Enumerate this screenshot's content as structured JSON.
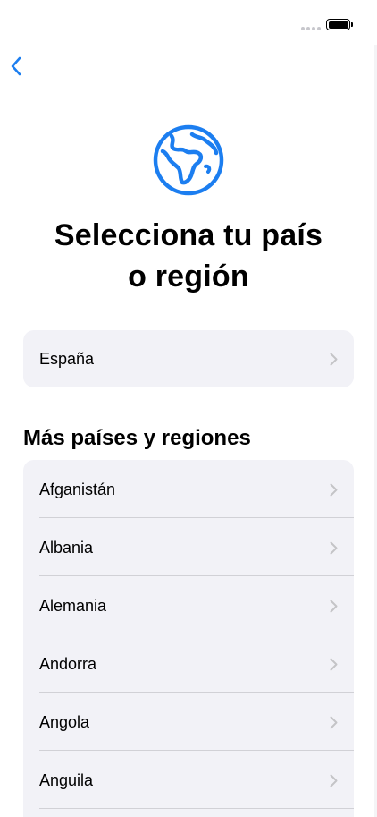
{
  "status_bar": {
    "signal_icon": "cellular-signal-icon",
    "battery_icon": "battery-full-icon"
  },
  "nav": {
    "back_icon": "chevron-left-icon"
  },
  "hero": {
    "icon": "globe-icon",
    "title_line1": "Selecciona tu país",
    "title_line2": "o región"
  },
  "current_region": {
    "label": "España"
  },
  "more_section": {
    "header": "Más países y regiones",
    "items": [
      {
        "label": "Afganistán"
      },
      {
        "label": "Albania"
      },
      {
        "label": "Alemania"
      },
      {
        "label": "Andorra"
      },
      {
        "label": "Angola"
      },
      {
        "label": "Anguila"
      }
    ]
  },
  "colors": {
    "accent": "#1c7ef0",
    "card_bg": "#f2f2f7",
    "chevron": "#c4c4c7",
    "divider": "#d1d1d6"
  }
}
